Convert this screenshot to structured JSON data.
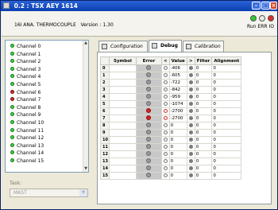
{
  "window": {
    "title": "0.2 : TSX AEY 1614",
    "controls": {
      "minimize": "–",
      "maximize": "□",
      "close": "×"
    }
  },
  "info": {
    "device": "16I ANA. THERMOCOUPLE",
    "version_label": "Version : 1.30",
    "leds": "Run ERR IO",
    "led_colors": {
      "run": "#2ecb2e",
      "err": "#e8e8e8",
      "io": "#e32b2b"
    }
  },
  "channels": [
    {
      "label": "Channel 0",
      "status": "ok"
    },
    {
      "label": "Channel 1",
      "status": "ok"
    },
    {
      "label": "Channel 2",
      "status": "ok"
    },
    {
      "label": "Channel 3",
      "status": "ok"
    },
    {
      "label": "Channel 4",
      "status": "ok"
    },
    {
      "label": "Channel 5",
      "status": "ok"
    },
    {
      "label": "Channel 6",
      "status": "error"
    },
    {
      "label": "Channel 7",
      "status": "error"
    },
    {
      "label": "Channel 8",
      "status": "ok"
    },
    {
      "label": "Channel 9",
      "status": "ok"
    },
    {
      "label": "Channel 10",
      "status": "ok"
    },
    {
      "label": "Channel 11",
      "status": "ok"
    },
    {
      "label": "Channel 12",
      "status": "ok"
    },
    {
      "label": "Channel 13",
      "status": "ok"
    },
    {
      "label": "Channel 14",
      "status": "ok"
    },
    {
      "label": "Channel 15",
      "status": "ok"
    }
  ],
  "task": {
    "label": "Task:",
    "value": "MAST"
  },
  "tabs": [
    {
      "label": "Configuration"
    },
    {
      "label": "Debug",
      "active": true
    },
    {
      "label": "Calibration"
    }
  ],
  "table": {
    "headers": [
      "",
      "Symbol",
      "Error",
      "<",
      "Value",
      ">",
      "Filter",
      "Alignment"
    ],
    "rows": [
      {
        "n": "0",
        "symbol": "",
        "error": "ok",
        "value": "-406",
        "filter": "0",
        "align": "0"
      },
      {
        "n": "1",
        "symbol": "",
        "error": "ok",
        "value": "-605",
        "filter": "0",
        "align": "0"
      },
      {
        "n": "2",
        "symbol": "",
        "error": "ok",
        "value": "-722",
        "filter": "0",
        "align": "0"
      },
      {
        "n": "3",
        "symbol": "",
        "error": "ok",
        "value": "-842",
        "filter": "0",
        "align": "0"
      },
      {
        "n": "4",
        "symbol": "",
        "error": "ok",
        "value": "-959",
        "filter": "0",
        "align": "0"
      },
      {
        "n": "5",
        "symbol": "",
        "error": "ok",
        "value": "-1074",
        "filter": "0",
        "align": "0"
      },
      {
        "n": "6",
        "symbol": "",
        "error": "error",
        "value": "-2700",
        "filter": "0",
        "align": "0"
      },
      {
        "n": "7",
        "symbol": "",
        "error": "error",
        "value": "-2700",
        "filter": "0",
        "align": "0"
      },
      {
        "n": "8",
        "symbol": "",
        "error": "ok",
        "value": "0",
        "filter": "0",
        "align": "0"
      },
      {
        "n": "9",
        "symbol": "",
        "error": "ok",
        "value": "0",
        "filter": "0",
        "align": "0"
      },
      {
        "n": "10",
        "symbol": "",
        "error": "ok",
        "value": "0",
        "filter": "0",
        "align": "0"
      },
      {
        "n": "11",
        "symbol": "",
        "error": "ok",
        "value": "0",
        "filter": "0",
        "align": "0"
      },
      {
        "n": "12",
        "symbol": "",
        "error": "ok",
        "value": "0",
        "filter": "0",
        "align": "0"
      },
      {
        "n": "13",
        "symbol": "",
        "error": "ok",
        "value": "0",
        "filter": "0",
        "align": "0"
      },
      {
        "n": "14",
        "symbol": "",
        "error": "ok",
        "value": "0",
        "filter": "0",
        "align": "0"
      },
      {
        "n": "15",
        "symbol": "",
        "error": "ok",
        "value": "0",
        "filter": "0",
        "align": "0"
      }
    ]
  }
}
